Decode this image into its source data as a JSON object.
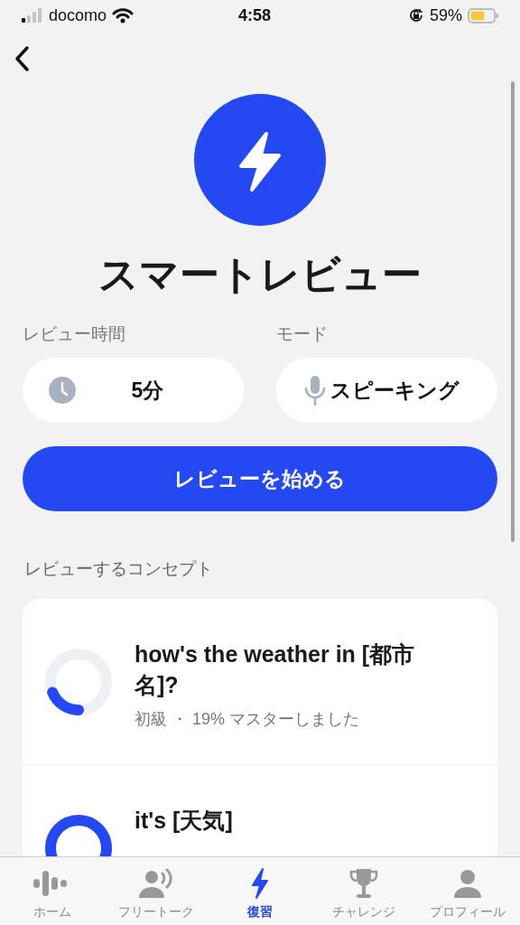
{
  "status_bar": {
    "carrier": "docomo",
    "time": "4:58",
    "battery": "59%"
  },
  "title": "スマートレビュー",
  "settings": [
    {
      "kind": "clock",
      "label": "レビュー時間",
      "value": "5分"
    },
    {
      "kind": "mic",
      "label": "モード",
      "value": "スピーキング"
    }
  ],
  "start_button": "レビューを始める",
  "section_title": "レビューするコンセプト",
  "concepts": [
    {
      "title": "how's the weather in [都市名]?",
      "subtitle": "初級 ・ 19% マスターしました",
      "level": 0.19
    },
    {
      "title": "it's [天気]"
    }
  ],
  "tabs": [
    {
      "kind": "home",
      "label": "ホーム",
      "selected": false
    },
    {
      "kind": "talk",
      "label": "フリートーク",
      "selected": false
    },
    {
      "kind": "bolt",
      "label": "復習",
      "selected": true
    },
    {
      "kind": "trophy",
      "label": "チャレンジ",
      "selected": false
    },
    {
      "kind": "person",
      "label": "プロフィール",
      "selected": false
    }
  ]
}
